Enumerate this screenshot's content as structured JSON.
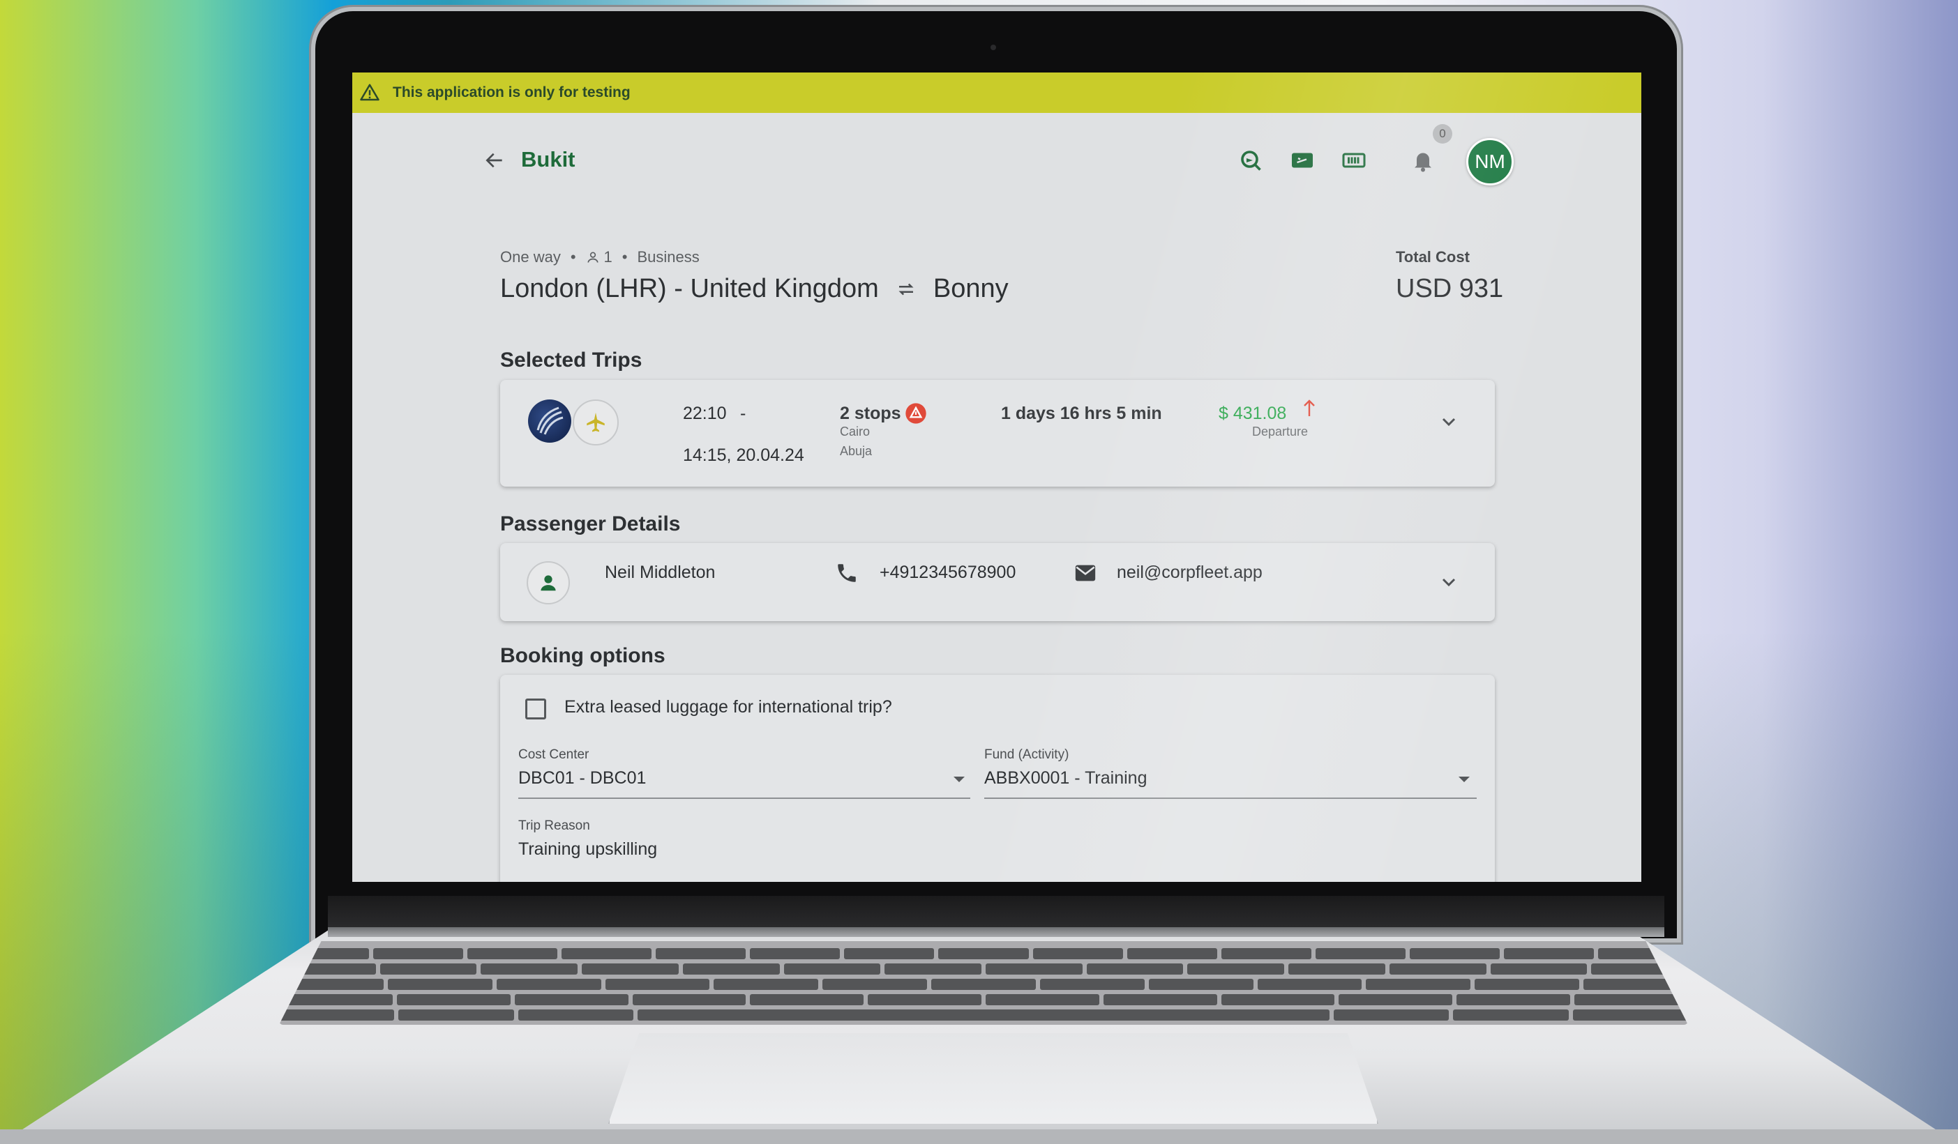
{
  "banner": {
    "text": "This application is only for testing"
  },
  "header": {
    "title": "Bukit",
    "notification_count": "0",
    "avatar_initials": "NM",
    "icons": [
      "arrow-back-icon",
      "flight-search-icon",
      "boarding-pass-icon",
      "ticket-icon",
      "bell-icon"
    ]
  },
  "trip_summary": {
    "trip_type": "One way",
    "passengers": "1",
    "cabin": "Business",
    "origin": "London (LHR) - United Kingdom",
    "destination": "Bonny",
    "total_cost_label": "Total Cost",
    "total_cost_value": "USD 931"
  },
  "selected_trips": {
    "title": "Selected Trips",
    "trip": {
      "depart_time": "22:10",
      "dash": "-",
      "arrive_time": "14:15, 20.04.24",
      "stops": "2 stops",
      "stop_cities": [
        "Cairo",
        "Abuja"
      ],
      "duration": "1 days 16 hrs 5 min",
      "price": "$ 431.08",
      "price_type": "Departure"
    }
  },
  "passenger_details": {
    "title": "Passenger Details",
    "name": "Neil Middleton",
    "phone": "+4912345678900",
    "email": "neil@corpfleet.app"
  },
  "booking_options": {
    "title": "Booking options",
    "luggage_label": "Extra leased luggage for international trip?",
    "luggage_checked": false,
    "cost_center_label": "Cost Center",
    "cost_center_value": "DBC01 - DBC01",
    "fund_label": "Fund (Activity)",
    "fund_value": "ABBX0001 - Training",
    "trip_reason_label": "Trip Reason",
    "trip_reason_value": "Training upskilling"
  },
  "colors": {
    "brand_green": "#1e6b3a",
    "banner_yellow": "#c9cc2a",
    "price_green": "#2fa84f",
    "alert_red": "#e04a3a"
  }
}
